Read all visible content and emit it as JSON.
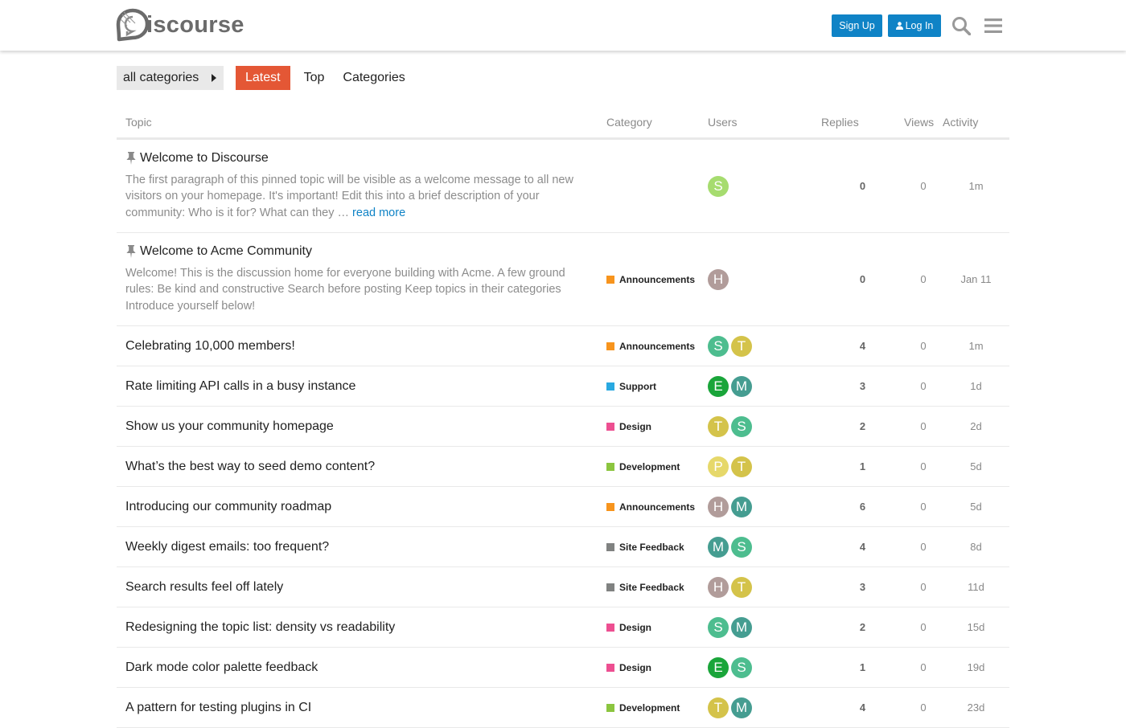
{
  "header": {
    "logo_text": "iscourse",
    "signup_label": "Sign Up",
    "login_label": "Log In"
  },
  "nav": {
    "category_dropdown": "all categories",
    "tabs": [
      {
        "label": "Latest",
        "active": true
      },
      {
        "label": "Top",
        "active": false
      },
      {
        "label": "Categories",
        "active": false
      }
    ]
  },
  "table": {
    "columns": {
      "topic": "Topic",
      "category": "Category",
      "users": "Users",
      "replies": "Replies",
      "views": "Views",
      "activity": "Activity"
    },
    "rows": [
      {
        "title": "Welcome to Discourse",
        "pinned": true,
        "excerpt": "The first paragraph of this pinned topic will be visible as a welcome message to all new visitors on your homepage. It's important! Edit this into a brief description of your community: Who is it for? What can they … ",
        "read_more": "read more",
        "category": "",
        "category_color": "",
        "users": [
          {
            "letter": "S",
            "color": "#a6dc6f"
          }
        ],
        "replies": "0",
        "views": "0",
        "activity": "1m"
      },
      {
        "title": "Welcome to Acme Community",
        "pinned": true,
        "excerpt": "Welcome! This is the discussion home for everyone building with Acme. A few ground rules: Be kind and constructive Search before posting Keep topics in their categories Introduce yourself below!",
        "read_more": "",
        "category": "Announcements",
        "category_color": "#f7941d",
        "users": [
          {
            "letter": "H",
            "color": "#b19c9a"
          }
        ],
        "replies": "0",
        "views": "0",
        "activity": "Jan 11"
      },
      {
        "title": "Celebrating 10,000 members!",
        "category": "Announcements",
        "category_color": "#f7941d",
        "users": [
          {
            "letter": "S",
            "color": "#4dbd8f"
          },
          {
            "letter": "T",
            "color": "#d4c34a"
          }
        ],
        "replies": "4",
        "views": "0",
        "activity": "1m"
      },
      {
        "title": "Rate limiting API calls in a busy instance",
        "category": "Support",
        "category_color": "#29a9e1",
        "users": [
          {
            "letter": "E",
            "color": "#1aa53a"
          },
          {
            "letter": "M",
            "color": "#459d91"
          }
        ],
        "replies": "3",
        "views": "0",
        "activity": "1d"
      },
      {
        "title": "Show us your community homepage",
        "category": "Design",
        "category_color": "#ed4f91",
        "users": [
          {
            "letter": "T",
            "color": "#d4c34a"
          },
          {
            "letter": "S",
            "color": "#4dbd8f"
          }
        ],
        "replies": "2",
        "views": "0",
        "activity": "2d"
      },
      {
        "title": "What’s the best way to seed demo content?",
        "category": "Development",
        "category_color": "#8bc53f",
        "users": [
          {
            "letter": "P",
            "color": "#e6d86a"
          },
          {
            "letter": "T",
            "color": "#d4c34a"
          }
        ],
        "replies": "1",
        "views": "0",
        "activity": "5d"
      },
      {
        "title": "Introducing our community roadmap",
        "category": "Announcements",
        "category_color": "#f7941d",
        "users": [
          {
            "letter": "H",
            "color": "#b19c9a"
          },
          {
            "letter": "M",
            "color": "#459d91"
          }
        ],
        "replies": "6",
        "views": "0",
        "activity": "5d"
      },
      {
        "title": "Weekly digest emails: too frequent?",
        "category": "Site Feedback",
        "category_color": "#808281",
        "users": [
          {
            "letter": "M",
            "color": "#459d91"
          },
          {
            "letter": "S",
            "color": "#4dbd8f"
          }
        ],
        "replies": "4",
        "views": "0",
        "activity": "8d"
      },
      {
        "title": "Search results feel off lately",
        "category": "Site Feedback",
        "category_color": "#808281",
        "users": [
          {
            "letter": "H",
            "color": "#b19c9a"
          },
          {
            "letter": "T",
            "color": "#d4c34a"
          }
        ],
        "replies": "3",
        "views": "0",
        "activity": "11d"
      },
      {
        "title": "Redesigning the topic list: density vs readability",
        "category": "Design",
        "category_color": "#ed4f91",
        "users": [
          {
            "letter": "S",
            "color": "#4dbd8f"
          },
          {
            "letter": "M",
            "color": "#459d91"
          }
        ],
        "replies": "2",
        "views": "0",
        "activity": "15d"
      },
      {
        "title": "Dark mode color palette feedback",
        "category": "Design",
        "category_color": "#ed4f91",
        "users": [
          {
            "letter": "E",
            "color": "#1aa53a"
          },
          {
            "letter": "S",
            "color": "#4dbd8f"
          }
        ],
        "replies": "1",
        "views": "0",
        "activity": "19d"
      },
      {
        "title": "A pattern for testing plugins in CI",
        "category": "Development",
        "category_color": "#8bc53f",
        "users": [
          {
            "letter": "T",
            "color": "#d4c34a"
          },
          {
            "letter": "M",
            "color": "#459d91"
          }
        ],
        "replies": "4",
        "views": "0",
        "activity": "23d"
      }
    ]
  }
}
